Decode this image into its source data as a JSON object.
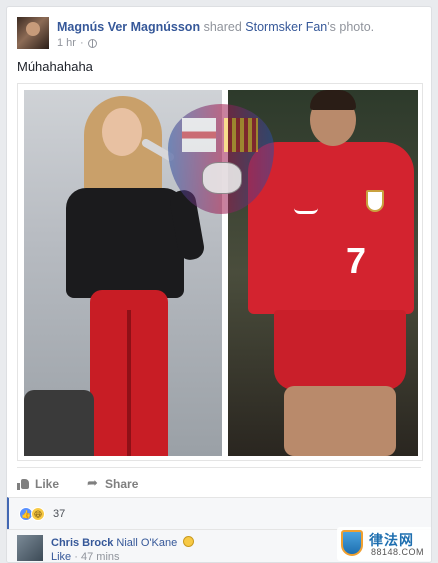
{
  "post": {
    "author": "Magnús Ver Magnússon",
    "action_text": "shared",
    "shared_from": "Stormsker Fan",
    "shared_suffix": "'s photo.",
    "time": "1 hr",
    "separator": "·",
    "text": "Múhahahaha"
  },
  "photo": {
    "left_figure_description": "singer with microphone",
    "right_figure_jersey_number": "7"
  },
  "actions": {
    "like_label": "Like",
    "share_label": "Share"
  },
  "reactions": {
    "count": "37",
    "icons": [
      "like-icon",
      "haha-icon"
    ]
  },
  "comment": {
    "author": "Chris Brock",
    "text": "Niall O'Kane",
    "like_label": "Like",
    "separator": "·",
    "time": "47 mins"
  },
  "watermark": {
    "title": "律法网",
    "subtitle": "88148.COM"
  },
  "colors": {
    "link": "#365899",
    "muted": "#90949c",
    "page_bg": "#e9ebee",
    "accent": "#4267b2"
  }
}
